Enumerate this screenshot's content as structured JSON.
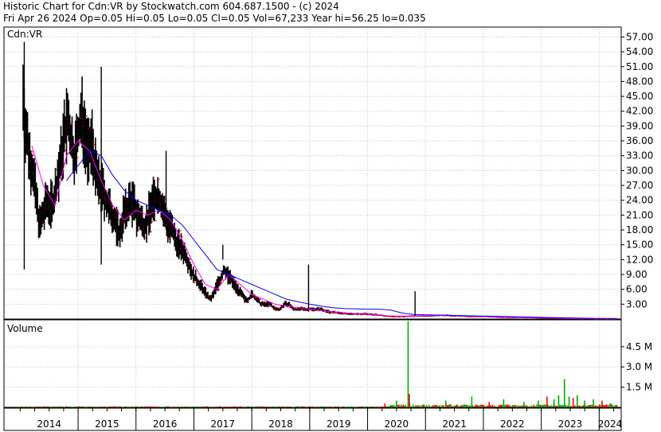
{
  "header": {
    "line1": "Historic Chart for Cdn:VR by Stockwatch.com 604.687.1500 - (c) 2024",
    "line2": "Fri Apr 26 2024   Op=0.05  Hi=0.05  Lo=0.05  Cl=0.05  Vol=67,233  Year hi=56.25  lo=0.035"
  },
  "colors": {
    "price_bar": "#000000",
    "price_close": "#ff0000",
    "ma_short": "#ff00ff",
    "ma_long": "#0000ff",
    "vol_up": "#00aa00",
    "vol_down": "#ff0000",
    "grid": "#c8c8c8"
  },
  "chart_data": [
    {
      "type": "ohlc",
      "title": "",
      "ylabel": "Cdn:VR",
      "ylim": [
        0,
        59
      ],
      "yticks": [
        "57.00",
        "54.00",
        "51.00",
        "48.00",
        "45.00",
        "42.00",
        "39.00",
        "36.00",
        "33.00",
        "30.00",
        "27.00",
        "24.00",
        "21.00",
        "18.00",
        "15.00",
        "12.00",
        "9.00",
        "6.00",
        "3.00"
      ],
      "grid": true,
      "x_years": [
        "2014",
        "2015",
        "2016",
        "2017",
        "2018",
        "2019",
        "2020",
        "2021",
        "2022",
        "2023",
        "2024"
      ],
      "price_points": [
        [
          2014.05,
          45
        ],
        [
          2014.1,
          38
        ],
        [
          2014.16,
          33
        ],
        [
          2014.22,
          30
        ],
        [
          2014.28,
          24
        ],
        [
          2014.34,
          19
        ],
        [
          2014.4,
          21
        ],
        [
          2014.46,
          24
        ],
        [
          2014.52,
          23
        ],
        [
          2014.58,
          24
        ],
        [
          2014.64,
          28
        ],
        [
          2014.7,
          32
        ],
        [
          2014.76,
          37
        ],
        [
          2014.82,
          40
        ],
        [
          2014.88,
          36
        ],
        [
          2014.94,
          33
        ],
        [
          2015.0,
          37
        ],
        [
          2015.06,
          41
        ],
        [
          2015.12,
          38
        ],
        [
          2015.18,
          33
        ],
        [
          2015.24,
          36
        ],
        [
          2015.3,
          30
        ],
        [
          2015.36,
          27
        ],
        [
          2015.42,
          26
        ],
        [
          2015.48,
          24
        ],
        [
          2015.54,
          22
        ],
        [
          2015.6,
          21
        ],
        [
          2015.66,
          19
        ],
        [
          2015.72,
          17
        ],
        [
          2015.78,
          21
        ],
        [
          2015.84,
          22
        ],
        [
          2015.9,
          24
        ],
        [
          2015.96,
          23
        ],
        [
          2016.02,
          21
        ],
        [
          2016.08,
          20
        ],
        [
          2016.14,
          19
        ],
        [
          2016.2,
          20
        ],
        [
          2016.26,
          23
        ],
        [
          2016.32,
          24
        ],
        [
          2016.38,
          25
        ],
        [
          2016.44,
          23
        ],
        [
          2016.5,
          21
        ],
        [
          2016.56,
          19
        ],
        [
          2016.62,
          18
        ],
        [
          2016.68,
          16
        ],
        [
          2016.74,
          15
        ],
        [
          2016.8,
          14
        ],
        [
          2016.86,
          13
        ],
        [
          2016.92,
          11
        ],
        [
          2016.98,
          9
        ],
        [
          2017.04,
          8
        ],
        [
          2017.1,
          7
        ],
        [
          2017.16,
          6
        ],
        [
          2017.22,
          5
        ],
        [
          2017.28,
          4
        ],
        [
          2017.34,
          5
        ],
        [
          2017.4,
          7
        ],
        [
          2017.46,
          8
        ],
        [
          2017.52,
          10
        ],
        [
          2017.58,
          9
        ],
        [
          2017.64,
          8
        ],
        [
          2017.7,
          7
        ],
        [
          2017.76,
          6
        ],
        [
          2017.82,
          5
        ],
        [
          2017.88,
          4
        ],
        [
          2017.94,
          4
        ],
        [
          2018.0,
          5
        ],
        [
          2018.08,
          4
        ],
        [
          2018.16,
          3
        ],
        [
          2018.24,
          3
        ],
        [
          2018.32,
          3
        ],
        [
          2018.4,
          2
        ],
        [
          2018.48,
          2
        ],
        [
          2018.56,
          3
        ],
        [
          2018.64,
          3
        ],
        [
          2018.72,
          2
        ],
        [
          2018.8,
          2
        ],
        [
          2018.88,
          2
        ],
        [
          2018.96,
          2
        ],
        [
          2019.04,
          2
        ],
        [
          2019.12,
          2
        ],
        [
          2019.2,
          2
        ],
        [
          2019.28,
          1.6
        ],
        [
          2019.36,
          1.4
        ],
        [
          2019.44,
          1.3
        ],
        [
          2019.5,
          1.2
        ],
        [
          2019.6,
          1.1
        ],
        [
          2020.0,
          1.0
        ],
        [
          2020.2,
          0.8
        ],
        [
          2020.4,
          0.5
        ],
        [
          2020.6,
          0.5
        ],
        [
          2020.8,
          0.6
        ],
        [
          2021.0,
          0.6
        ],
        [
          2021.2,
          0.7
        ],
        [
          2021.4,
          0.7
        ],
        [
          2021.6,
          0.6
        ],
        [
          2021.8,
          0.5
        ],
        [
          2022.0,
          0.5
        ],
        [
          2022.2,
          0.4
        ],
        [
          2022.4,
          0.3
        ],
        [
          2022.6,
          0.3
        ],
        [
          2022.8,
          0.3
        ],
        [
          2023.0,
          0.2
        ],
        [
          2023.2,
          0.2
        ],
        [
          2023.4,
          0.15
        ],
        [
          2023.6,
          0.1
        ],
        [
          2023.8,
          0.08
        ],
        [
          2024.0,
          0.06
        ],
        [
          2024.3,
          0.05
        ]
      ],
      "ma_short": [
        [
          2014.2,
          35
        ],
        [
          2014.4,
          27
        ],
        [
          2014.6,
          23
        ],
        [
          2014.8,
          33
        ],
        [
          2015.0,
          36
        ],
        [
          2015.2,
          34
        ],
        [
          2015.4,
          28
        ],
        [
          2015.6,
          23
        ],
        [
          2015.8,
          20
        ],
        [
          2016.0,
          22
        ],
        [
          2016.2,
          21
        ],
        [
          2016.4,
          22
        ],
        [
          2016.6,
          20
        ],
        [
          2016.8,
          16
        ],
        [
          2017.0,
          11
        ],
        [
          2017.2,
          7
        ],
        [
          2017.4,
          6
        ],
        [
          2017.6,
          9
        ],
        [
          2017.8,
          7
        ],
        [
          2018.0,
          5
        ],
        [
          2018.2,
          4
        ],
        [
          2018.4,
          3
        ],
        [
          2018.6,
          2.6
        ],
        [
          2018.8,
          2.3
        ],
        [
          2019.0,
          2
        ],
        [
          2019.2,
          1.7
        ],
        [
          2019.4,
          1.4
        ],
        [
          2019.6,
          1.2
        ],
        [
          2020.0,
          1.0
        ],
        [
          2020.4,
          0.6
        ],
        [
          2020.8,
          0.6
        ],
        [
          2021.2,
          0.7
        ],
        [
          2021.6,
          0.6
        ],
        [
          2022.0,
          0.5
        ],
        [
          2022.4,
          0.35
        ],
        [
          2022.8,
          0.3
        ],
        [
          2023.2,
          0.2
        ],
        [
          2023.6,
          0.12
        ],
        [
          2024.0,
          0.07
        ],
        [
          2024.3,
          0.05
        ]
      ],
      "ma_long": [
        [
          2014.8,
          28
        ],
        [
          2015.0,
          31
        ],
        [
          2015.2,
          34
        ],
        [
          2015.4,
          33
        ],
        [
          2015.6,
          29
        ],
        [
          2015.8,
          26
        ],
        [
          2016.0,
          24
        ],
        [
          2016.2,
          23
        ],
        [
          2016.4,
          22
        ],
        [
          2016.6,
          21
        ],
        [
          2016.8,
          19
        ],
        [
          2017.0,
          16
        ],
        [
          2017.2,
          13
        ],
        [
          2017.4,
          10
        ],
        [
          2017.6,
          9
        ],
        [
          2017.8,
          8
        ],
        [
          2018.0,
          7
        ],
        [
          2018.2,
          6
        ],
        [
          2018.4,
          5
        ],
        [
          2018.6,
          4
        ],
        [
          2018.8,
          3.5
        ],
        [
          2019.0,
          3
        ],
        [
          2019.2,
          2.6
        ],
        [
          2019.4,
          2.3
        ],
        [
          2019.6,
          2.1
        ],
        [
          2020.0,
          2.0
        ],
        [
          2020.2,
          2.0
        ],
        [
          2020.4,
          1.8
        ],
        [
          2020.6,
          1.2
        ],
        [
          2020.8,
          0.9
        ],
        [
          2021.2,
          0.8
        ],
        [
          2021.6,
          0.7
        ],
        [
          2022.0,
          0.6
        ],
        [
          2022.4,
          0.5
        ],
        [
          2022.8,
          0.4
        ],
        [
          2023.2,
          0.3
        ],
        [
          2023.6,
          0.2
        ],
        [
          2024.0,
          0.12
        ],
        [
          2024.3,
          0.1
        ]
      ],
      "spikes": [
        [
          2014.07,
          10,
          56
        ],
        [
          2015.4,
          11,
          51
        ],
        [
          2016.52,
          18,
          34
        ],
        [
          2017.5,
          12,
          15
        ],
        [
          2018.98,
          1.5,
          11
        ],
        [
          2020.82,
          0.6,
          5.6
        ]
      ]
    },
    {
      "type": "bar",
      "title": "",
      "ylabel": "Volume",
      "unit": "M",
      "ylim": [
        0,
        6.5
      ],
      "yticks": [
        "4.5 M",
        "3.0 M",
        "1.5 M"
      ],
      "volume_events": [
        [
          2020.7,
          6.4,
          "up"
        ],
        [
          2020.72,
          1.0,
          "down"
        ],
        [
          2020.5,
          0.5,
          "up"
        ],
        [
          2020.3,
          0.3,
          "down"
        ],
        [
          2021.35,
          0.5,
          "up"
        ],
        [
          2021.8,
          0.8,
          "up"
        ],
        [
          2022.1,
          0.4,
          "down"
        ],
        [
          2022.35,
          0.6,
          "up"
        ],
        [
          2022.7,
          0.4,
          "up"
        ],
        [
          2022.95,
          0.5,
          "up"
        ],
        [
          2023.1,
          0.8,
          "down"
        ],
        [
          2023.22,
          0.6,
          "up"
        ],
        [
          2023.3,
          0.9,
          "up"
        ],
        [
          2023.4,
          2.1,
          "up"
        ],
        [
          2023.48,
          0.8,
          "up"
        ],
        [
          2023.55,
          0.7,
          "down"
        ],
        [
          2023.62,
          0.9,
          "up"
        ],
        [
          2023.75,
          0.5,
          "up"
        ],
        [
          2023.9,
          0.6,
          "up"
        ],
        [
          2024.05,
          0.5,
          "down"
        ],
        [
          2024.2,
          0.3,
          "up"
        ]
      ]
    }
  ]
}
